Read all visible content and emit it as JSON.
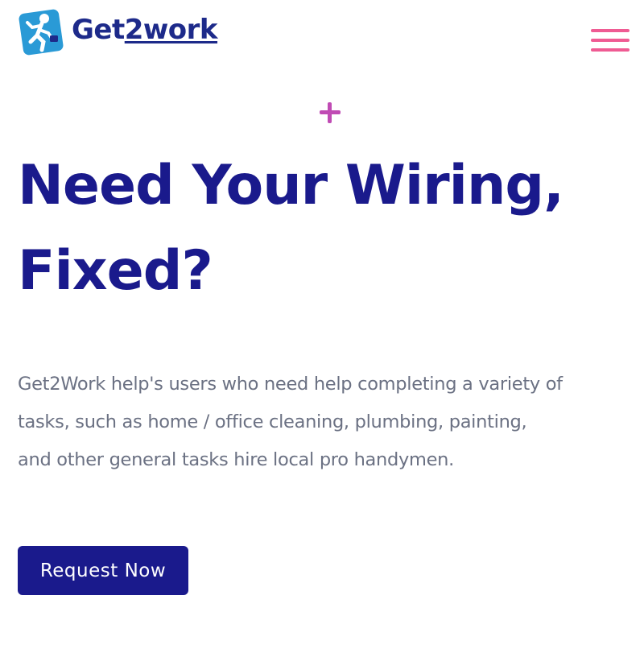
{
  "header": {
    "logo_text_prefix": "Get",
    "logo_text_underlined": "2work",
    "logo_icon": "runner-icon",
    "menu_icon": "hamburger-menu-icon"
  },
  "hero": {
    "decoration_icon": "plus-icon",
    "title_lines": [
      "Need Your  Wiring,",
      "Fixed?"
    ],
    "description_lines": [
      "Get2Work help's users who need help completing a variety of",
      "tasks, such as home / office cleaning, plumbing, painting,",
      "and other general tasks hire local pro handymen."
    ],
    "cta_label": "Request Now"
  },
  "colors": {
    "brand_navy": "#1a1a8c",
    "logo_blue": "#2a9ad6",
    "menu_pink": "#ef5b93",
    "plus_magenta": "#c04bb4",
    "body_gray": "#6b7183"
  }
}
